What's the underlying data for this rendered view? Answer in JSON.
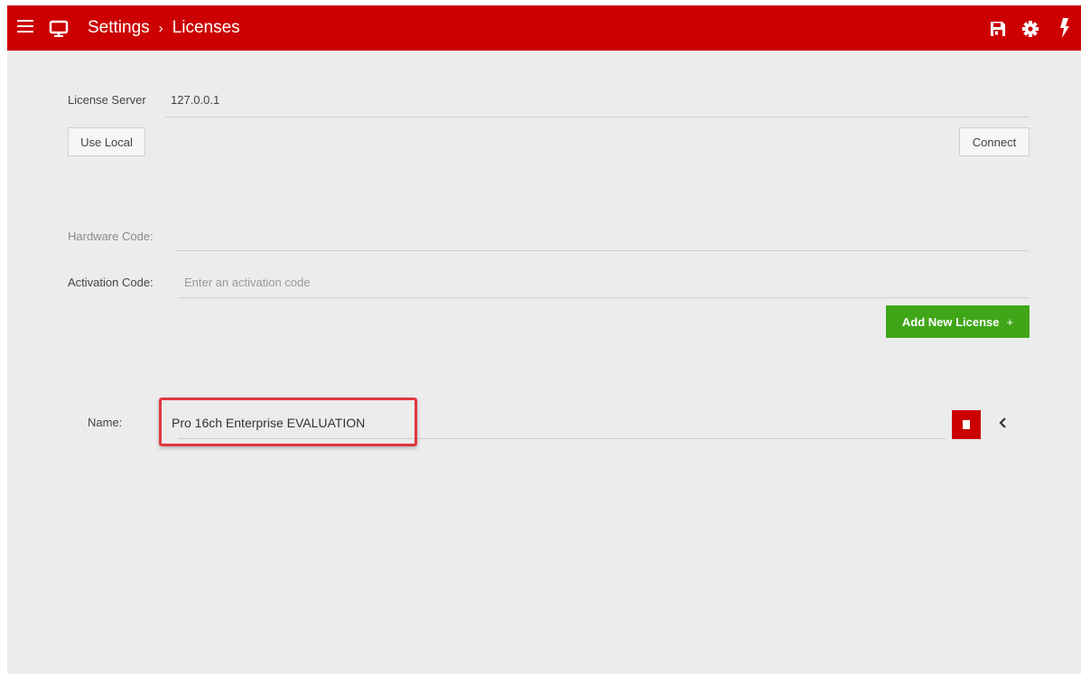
{
  "header": {
    "breadcrumb": [
      "Settings",
      "Licenses"
    ],
    "breadcrumb_separator": "›",
    "icons": [
      "menu-icon",
      "monitor-icon",
      "save-icon",
      "gear-icon",
      "lightning-bolt-icon"
    ]
  },
  "license_server": {
    "label": "License Server",
    "value": "127.0.0.1",
    "use_local_label": "Use Local",
    "connect_label": "Connect"
  },
  "hardware_code": {
    "label": "Hardware Code:",
    "value": ""
  },
  "activation_code": {
    "label": "Activation Code:",
    "value": "",
    "placeholder": "Enter an activation code"
  },
  "add_license": {
    "label": "Add New License",
    "icon": "+"
  },
  "license": {
    "name_label": "Name:",
    "name_value": "Pro 16ch Enterprise EVALUATION",
    "delete_icon": "trash-icon",
    "expand_icon": "chevron-left-icon"
  },
  "colors": {
    "header_red": "#cc0000",
    "accent_green": "#3fa617",
    "highlight_red": "#e0373d",
    "background": "#ececec"
  }
}
